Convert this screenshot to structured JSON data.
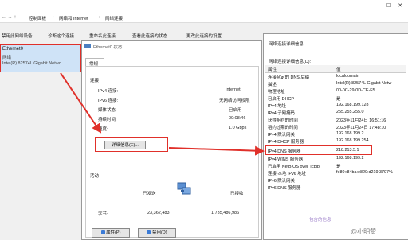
{
  "breadcrumb": {
    "sep": "›",
    "items": [
      "控制面板",
      "网络和 Internet",
      "网络连接"
    ],
    "nav_glyphs": "← → ↑"
  },
  "toolbar": {
    "items": [
      "禁用此网络设备",
      "诊断这个连接",
      "重命名此连接",
      "查看此连接的状态",
      "更改此连接的设置"
    ]
  },
  "adapter": {
    "name": "Ethernet0",
    "network": "网络",
    "device": "Intel(R) 82574L Gigabit Netwo..."
  },
  "status_dialog": {
    "title": "Ethernet0 状态",
    "tab": "常规",
    "connection_header": "连接",
    "fields": [
      {
        "label": "IPv4 连接:",
        "value": "Internet"
      },
      {
        "label": "IPv6 连接:",
        "value": "无网络访问权限"
      },
      {
        "label": "媒体状态:",
        "value": "已启用"
      },
      {
        "label": "持续时间:",
        "value": "00:08:46"
      },
      {
        "label": "速度:",
        "value": "1.0 Gbps"
      }
    ],
    "details_button": "详细信息(E)...",
    "activity_header": "活动",
    "sent_label": "已发送",
    "received_label": "已接收",
    "bytes_label": "字节:",
    "sent_bytes": "23,362,483",
    "received_bytes": "1,735,486,986",
    "properties_button": "属性(P)",
    "disable_button": "禁用(D)"
  },
  "detail_dialog": {
    "title": "网络连接详细信息",
    "subtitle": "网络连接详细信息(D):",
    "col_property": "属性",
    "col_value": "值",
    "rows": [
      {
        "p": "连接特定的 DNS 后缀",
        "v": "localdomain"
      },
      {
        "p": "描述",
        "v": "Intel(R) 82574L Gigabit Netw"
      },
      {
        "p": "物理地址",
        "v": "00-0C-29-0D-CE-F5"
      },
      {
        "p": "已启用 DHCP",
        "v": "是"
      },
      {
        "p": "IPv4 地址",
        "v": "192.168.199.128"
      },
      {
        "p": "IPv4 子网掩码",
        "v": "255.255.255.0"
      },
      {
        "p": "获得租约的时间",
        "v": "2023年11月24日 16:51:16"
      },
      {
        "p": "租约过期的时间",
        "v": "2023年11月24日 17:48:10"
      },
      {
        "p": "IPv4 默认网关",
        "v": "192.168.199.2"
      },
      {
        "p": "IPv4 DHCP 服务器",
        "v": "192.168.199.254"
      },
      {
        "p": "IPv4 DNS 服务器",
        "v": "218.213.5.1"
      },
      {
        "p": "IPv4 WINS 服务器",
        "v": "192.168.199.2"
      },
      {
        "p": "已启用 NetBIOS over Tcpip",
        "v": "是"
      },
      {
        "p": "连接-本地 IPv6 地址",
        "v": "fe80::84ba:e820:d219:3797%"
      },
      {
        "p": "IPv6 默认网关",
        "v": ""
      },
      {
        "p": "IPv6 DNS 服务器",
        "v": ""
      }
    ]
  },
  "watermark": "@小明赞",
  "corner_note": "包含的信息",
  "colors": {
    "accent_red": "#e0302a",
    "selection": "#cfe3f7"
  }
}
